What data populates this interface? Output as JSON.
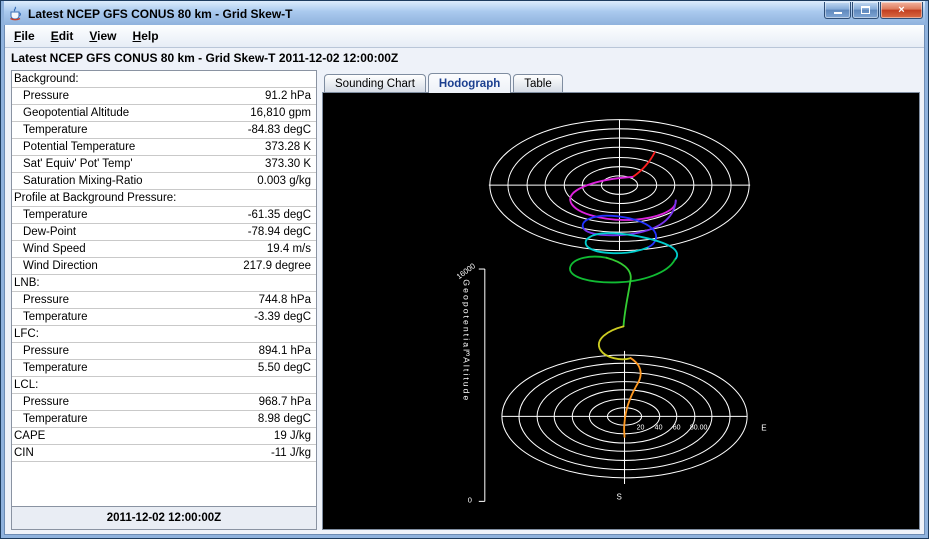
{
  "window": {
    "title": "Latest NCEP GFS CONUS 80 km - Grid Skew-T",
    "controls": {
      "close_glyph": "×"
    }
  },
  "menubar": {
    "items": [
      {
        "label": "File"
      },
      {
        "label": "Edit"
      },
      {
        "label": "View"
      },
      {
        "label": "Help"
      }
    ]
  },
  "header": {
    "title": "Latest NCEP GFS CONUS 80 km - Grid Skew-T 2011-12-02 12:00:00Z"
  },
  "sidebar": {
    "rows": [
      {
        "label": "Background:",
        "value": ""
      },
      {
        "label": "Pressure",
        "value": "91.2 hPa"
      },
      {
        "label": "Geopotential Altitude",
        "value": "16,810 gpm"
      },
      {
        "label": "Temperature",
        "value": "-84.83 degC"
      },
      {
        "label": "Potential Temperature",
        "value": "373.28 K"
      },
      {
        "label": "Sat' Equiv' Pot' Temp'",
        "value": "373.30 K"
      },
      {
        "label": "Saturation Mixing-Ratio",
        "value": "0.003 g/kg"
      },
      {
        "label": "Profile at Background Pressure:",
        "value": ""
      },
      {
        "label": "Temperature",
        "value": "-61.35 degC"
      },
      {
        "label": "Dew-Point",
        "value": "-78.94 degC"
      },
      {
        "label": "Wind Speed",
        "value": "19.4 m/s"
      },
      {
        "label": "Wind Direction",
        "value": "217.9 degree"
      },
      {
        "label": "LNB:",
        "value": ""
      },
      {
        "label": "Pressure",
        "value": "744.8 hPa"
      },
      {
        "label": "Temperature",
        "value": "-3.39 degC"
      },
      {
        "label": "LFC:",
        "value": ""
      },
      {
        "label": "Pressure",
        "value": "894.1 hPa"
      },
      {
        "label": "Temperature",
        "value": "5.50 degC"
      },
      {
        "label": "LCL:",
        "value": ""
      },
      {
        "label": "Pressure",
        "value": "968.7 hPa"
      },
      {
        "label": "Temperature",
        "value": "8.98 degC"
      },
      {
        "label": "CAPE",
        "value": "19 J/kg"
      },
      {
        "label": "CIN",
        "value": "-11 J/kg"
      }
    ],
    "footer": "2011-12-02 12:00:00Z"
  },
  "tabs": {
    "items": [
      {
        "label": "Sounding Chart",
        "selected": false
      },
      {
        "label": "Hodograph",
        "selected": true
      },
      {
        "label": "Table",
        "selected": false
      }
    ]
  },
  "hodograph": {
    "y_axis": {
      "title": "Geopotential Altitude",
      "ticks": [
        "16000",
        "3",
        "0"
      ]
    },
    "ring_labels": [
      "20",
      "40",
      "60",
      "80.00"
    ],
    "compass": {
      "east": "E",
      "south": "S"
    }
  }
}
